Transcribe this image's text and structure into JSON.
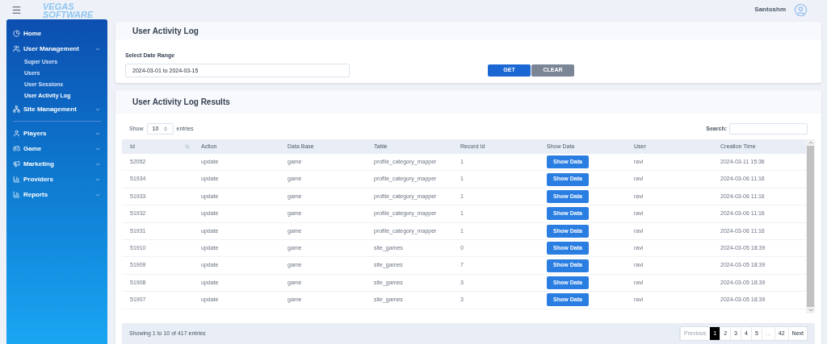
{
  "header": {
    "logo_top": "VEGAS",
    "logo_bottom": "SOFTWARE",
    "user": "Santoshm"
  },
  "sidebar": {
    "items": [
      {
        "label": "Home",
        "kind": "link"
      },
      {
        "label": "User Management",
        "kind": "group",
        "children": [
          {
            "label": "Super Users",
            "selected": false
          },
          {
            "label": "Users",
            "selected": false
          },
          {
            "label": "User Sessions",
            "selected": false
          },
          {
            "label": "User Activity Log",
            "selected": true
          }
        ]
      },
      {
        "label": "Site Management",
        "kind": "group"
      },
      {
        "label": "Players",
        "kind": "group"
      },
      {
        "label": "Game",
        "kind": "group"
      },
      {
        "label": "Marketing",
        "kind": "group"
      },
      {
        "label": "Providers",
        "kind": "group"
      },
      {
        "label": "Reports",
        "kind": "group"
      }
    ]
  },
  "filter_card": {
    "title": "User Activity Log",
    "label": "Select Date Range",
    "value": "2024-03-01 to 2024-03-15",
    "buttons": [
      {
        "label": "GET",
        "kind": "primary"
      },
      {
        "label": "CLEAR",
        "kind": "secondary"
      }
    ]
  },
  "results_card": {
    "title": "User Activity Log Results",
    "show_label": "Show",
    "page_size": "10",
    "entries_label": "entries",
    "search_label": "Search:",
    "columns": [
      "Id",
      "Action",
      "Data Base",
      "Table",
      "Record Id",
      "Show Data",
      "User",
      "Creation Time"
    ],
    "rows": [
      {
        "id": "52052",
        "action": "update",
        "db": "game",
        "table": "profile_category_mapper",
        "record": "1",
        "button": "Show Data",
        "user": "ravi",
        "time": "2024-03-11 15:36"
      },
      {
        "id": "51934",
        "action": "update",
        "db": "game",
        "table": "profile_category_mapper",
        "record": "1",
        "button": "Show Data",
        "user": "ravi",
        "time": "2024-03-06 11:16"
      },
      {
        "id": "51933",
        "action": "update",
        "db": "game",
        "table": "profile_category_mapper",
        "record": "1",
        "button": "Show Data",
        "user": "ravi",
        "time": "2024-03-06 11:16"
      },
      {
        "id": "51932",
        "action": "update",
        "db": "game",
        "table": "profile_category_mapper",
        "record": "1",
        "button": "Show Data",
        "user": "ravi",
        "time": "2024-03-06 11:16"
      },
      {
        "id": "51931",
        "action": "update",
        "db": "game",
        "table": "profile_category_mapper",
        "record": "1",
        "button": "Show Data",
        "user": "ravi",
        "time": "2024-03-06 11:16"
      },
      {
        "id": "51910",
        "action": "update",
        "db": "game",
        "table": "site_games",
        "record": "0",
        "button": "Show Data",
        "user": "ravi",
        "time": "2024-03-05 18:39"
      },
      {
        "id": "51909",
        "action": "update",
        "db": "game",
        "table": "site_games",
        "record": "7",
        "button": "Show Data",
        "user": "ravi",
        "time": "2024-03-05 18:39"
      },
      {
        "id": "51908",
        "action": "update",
        "db": "game",
        "table": "site_games",
        "record": "3",
        "button": "Show Data",
        "user": "ravi",
        "time": "2024-03-05 18:39"
      },
      {
        "id": "51907",
        "action": "update",
        "db": "game",
        "table": "site_games",
        "record": "3",
        "button": "Show Data",
        "user": "ravi",
        "time": "2024-03-05 18:39"
      }
    ],
    "info": "Showing 1 to 10 of 417 entries",
    "pages": [
      {
        "label": "Previous",
        "selected": false,
        "disabled": true
      },
      {
        "label": "1",
        "selected": true,
        "disabled": false
      },
      {
        "label": "2",
        "selected": false,
        "disabled": false
      },
      {
        "label": "3",
        "selected": false,
        "disabled": false
      },
      {
        "label": "4",
        "selected": false,
        "disabled": false
      },
      {
        "label": "5",
        "selected": false,
        "disabled": false
      },
      {
        "label": "…",
        "selected": false,
        "disabled": true
      },
      {
        "label": "42",
        "selected": false,
        "disabled": false
      },
      {
        "label": "Next",
        "selected": false,
        "disabled": false
      }
    ]
  }
}
